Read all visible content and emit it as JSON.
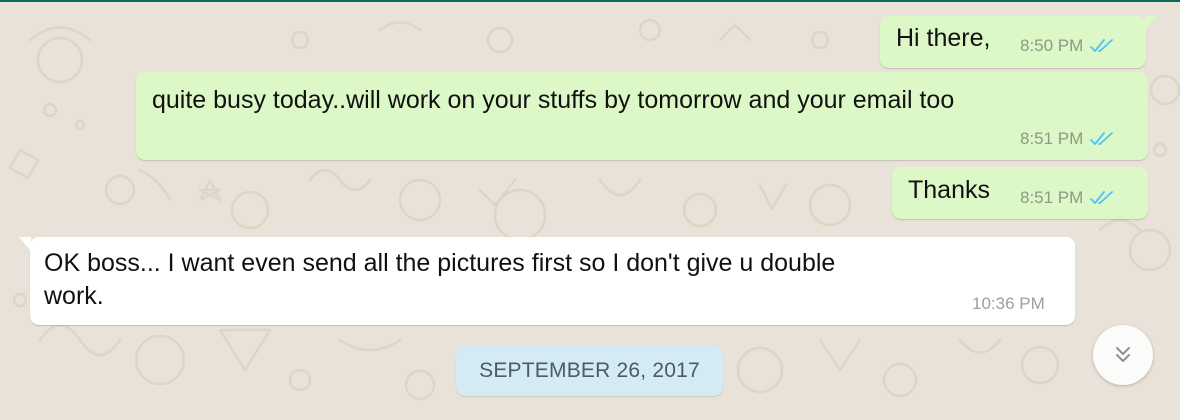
{
  "conversation": {
    "messages": [
      {
        "direction": "outgoing",
        "text": "Hi there,",
        "time": "8:50 PM",
        "status": "read"
      },
      {
        "direction": "outgoing",
        "text": "quite busy today..will work on your stuffs by tomorrow and your email too",
        "time": "8:51 PM",
        "status": "read"
      },
      {
        "direction": "outgoing",
        "text": "Thanks",
        "time": "8:51 PM",
        "status": "read"
      },
      {
        "direction": "incoming",
        "lines": [
          "OK boss... I want even send all the pictures first so I don't give u double",
          "work."
        ],
        "time": "10:36 PM"
      }
    ],
    "date_separator": "SEPTEMBER 26, 2017"
  },
  "icons": {
    "read_receipt": "double-check-icon",
    "scroll_down": "double-chevron-down-icon"
  },
  "colors": {
    "outgoing_bubble": "#dcf8c6",
    "incoming_bubble": "#ffffff",
    "chat_background": "#e9e2d8",
    "read_ticks": "#4fc3f7",
    "date_chip": "#d4eaf4"
  }
}
